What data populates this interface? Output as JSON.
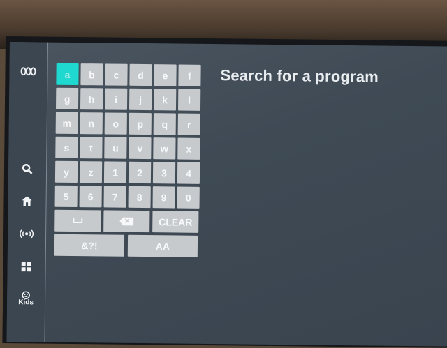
{
  "header": {
    "title": "Search for a program"
  },
  "sidebar": {
    "items": [
      {
        "name": "abc-logo-icon"
      },
      {
        "name": "search-icon"
      },
      {
        "name": "home-icon"
      },
      {
        "name": "live-icon"
      },
      {
        "name": "categories-icon"
      },
      {
        "name": "kids-icon",
        "label": "Kids"
      }
    ]
  },
  "keyboard": {
    "rows": [
      [
        "a",
        "b",
        "c",
        "d",
        "e",
        "f"
      ],
      [
        "g",
        "h",
        "i",
        "j",
        "k",
        "l"
      ],
      [
        "m",
        "n",
        "o",
        "p",
        "q",
        "r"
      ],
      [
        "s",
        "t",
        "u",
        "v",
        "w",
        "x"
      ],
      [
        "y",
        "z",
        "1",
        "2",
        "3",
        "4"
      ],
      [
        "5",
        "6",
        "7",
        "8",
        "9",
        "0"
      ]
    ],
    "active_key": "a",
    "clear_label": "CLEAR",
    "symbols_label": "&?!",
    "case_label": "AA"
  },
  "colors": {
    "accent": "#1fd9d0",
    "key_bg": "#c7cacd",
    "screen_bg": "#3f4a55"
  }
}
